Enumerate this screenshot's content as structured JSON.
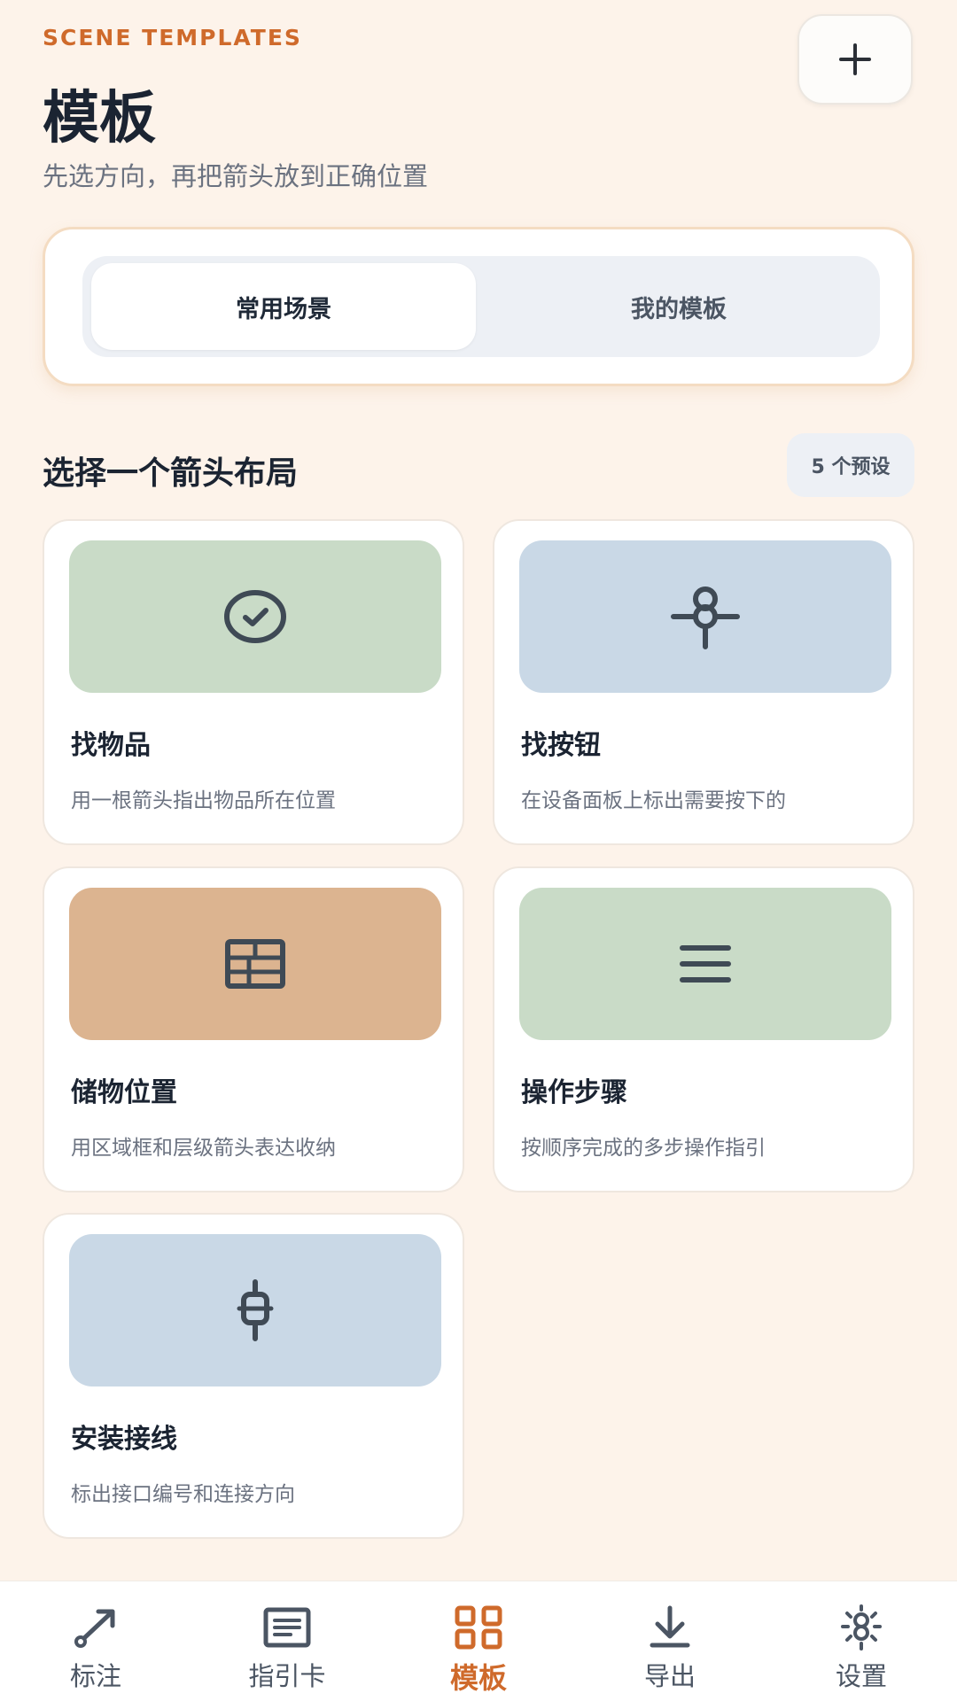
{
  "header": {
    "eyebrow": "SCENE TEMPLATES",
    "title": "模板",
    "subtitle": "先选方向，再把箭头放到正确位置",
    "add_icon": "plus-icon"
  },
  "segments": {
    "active": "常用场景",
    "inactive": "我的模板"
  },
  "section": {
    "title": "选择一个箭头布局",
    "count": "5 个预设"
  },
  "cards": [
    {
      "name": "找物品",
      "desc": "用一根箭头指出物品所在位置",
      "icon": "check-circle-icon",
      "color": "#c9dbc7"
    },
    {
      "name": "找按钮",
      "desc": "在设备面板上标出需要按下的",
      "icon": "pointer-target-icon",
      "color": "#c9d8e6"
    },
    {
      "name": "储物位置",
      "desc": "用区域框和层级箭头表达收纳",
      "icon": "grid-box-icon",
      "color": "#dcb490"
    },
    {
      "name": "操作步骤",
      "desc": "按顺序完成的多步操作指引",
      "icon": "list-lines-icon",
      "color": "#c9dbc7"
    },
    {
      "name": "安装接线",
      "desc": "标出接口编号和连接方向",
      "icon": "plug-icon",
      "color": "#c9d8e6"
    }
  ],
  "nav": [
    {
      "label": "标注",
      "icon": "arrow-annotate-icon",
      "active": false
    },
    {
      "label": "指引卡",
      "icon": "guide-card-icon",
      "active": false
    },
    {
      "label": "模板",
      "icon": "template-grid-icon",
      "active": true
    },
    {
      "label": "导出",
      "icon": "download-icon",
      "active": false
    },
    {
      "label": "设置",
      "icon": "settings-sun-icon",
      "active": false
    }
  ],
  "colors": {
    "accent": "#cf6a2b",
    "background": "#fdf3ea",
    "icon_dark": "#3f4a55"
  }
}
